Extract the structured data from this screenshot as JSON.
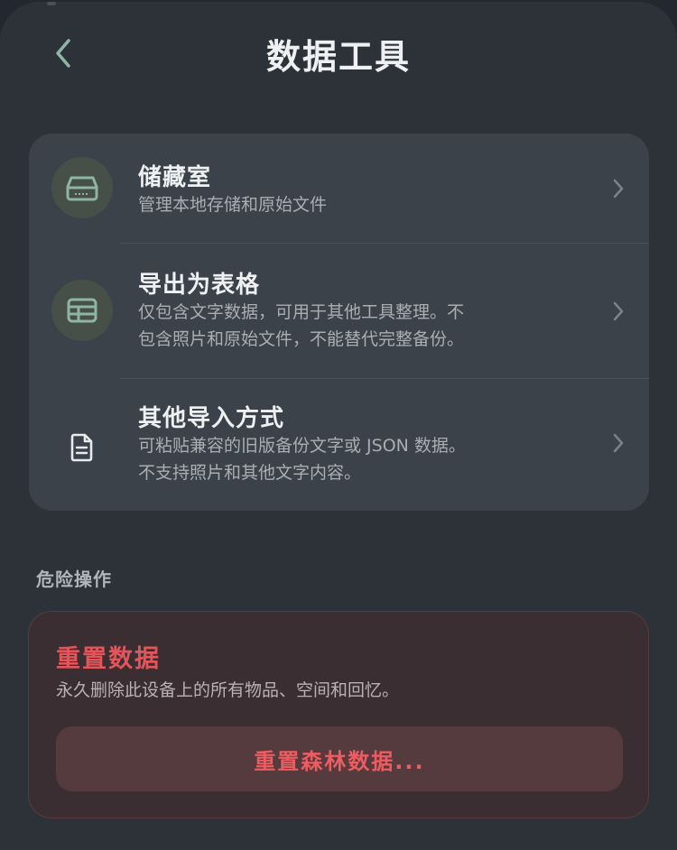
{
  "header": {
    "title": "数据工具",
    "back_icon": "chevron-left-icon"
  },
  "tools": {
    "items": [
      {
        "title": "储藏室",
        "description": "管理本地存储和原始文件",
        "icon": "storage-drive-icon"
      },
      {
        "title": "导出为表格",
        "description_line1": "仅包含文字数据，可用于其他工具整理。不",
        "description_line2": "包含照片和原始文件，不能替代完整备份。",
        "icon": "table-icon"
      },
      {
        "title": "其他导入方式",
        "description_line1": "可粘贴兼容的旧版备份文字或 JSON 数据。",
        "description_line2": "不支持照片和其他文字内容。",
        "icon": "document-icon"
      }
    ]
  },
  "danger": {
    "section_label": "危险操作",
    "title": "重置数据",
    "description": "永久删除此设备上的所有物品、空间和回忆。",
    "button_label": "重置森林数据..."
  },
  "colors": {
    "accent_green": "#8fb5a4",
    "danger_red": "#e2555b",
    "card_bg": "#3b4249",
    "sheet_bg": "#2d3239"
  }
}
